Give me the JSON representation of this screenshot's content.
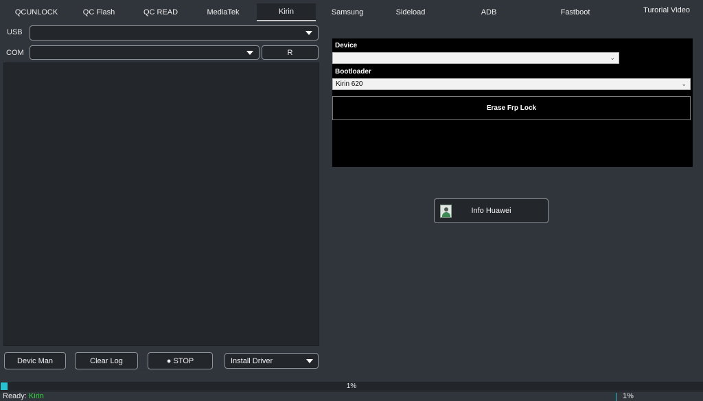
{
  "tabs": [
    {
      "label": "QCUNLOCK"
    },
    {
      "label": "QC Flash"
    },
    {
      "label": "QC READ"
    },
    {
      "label": "MediaTek"
    },
    {
      "label": "Kirin"
    },
    {
      "label": "Samsung"
    },
    {
      "label": "Sideload"
    },
    {
      "label": "ADB"
    },
    {
      "label": "Fastboot"
    },
    {
      "label": "Turorial Video"
    }
  ],
  "active_tab": "Kirin",
  "connection": {
    "usb_label": "USB",
    "usb_value": "",
    "com_label": "COM",
    "com_value": "",
    "refresh_label": "R"
  },
  "log": {
    "text": ""
  },
  "bottom_buttons": {
    "device_manager": "Devic Man",
    "clear_log": "Clear Log",
    "stop": "● STOP",
    "install_driver": "Install Driver"
  },
  "kirin_panel": {
    "device_label": "Device",
    "device_value": "",
    "bootloader_label": "Bootloader",
    "bootloader_value": "Kirin 620",
    "erase_button": "Erase Frp Lock"
  },
  "info_button": {
    "label": "Info Huawei",
    "icon": "user-avatar-icon"
  },
  "progress": {
    "value": 0.01,
    "label": "1%"
  },
  "status_bar": {
    "ready_label": "Ready:",
    "current_tab": "Kirin",
    "percent": "1%",
    "ready_color": "#2fd23e"
  },
  "colors": {
    "background": "#30353b",
    "control_background": "#23272c",
    "progress_fill": "#25c2d4",
    "panel_background": "#000000"
  }
}
